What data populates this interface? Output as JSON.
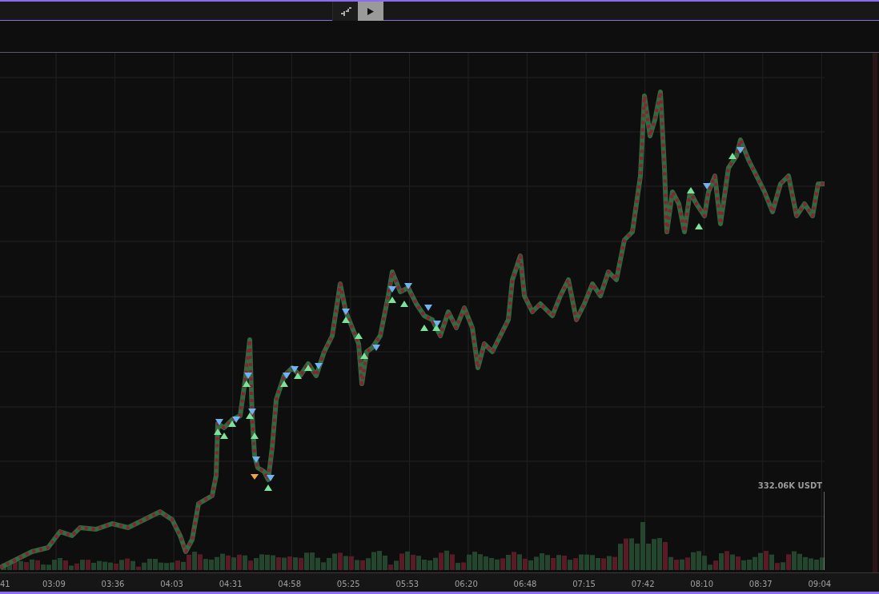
{
  "toolbar": {
    "buttons": [
      {
        "kind": "chart-style",
        "selected": false
      },
      {
        "kind": "play",
        "selected": true
      }
    ]
  },
  "volume": {
    "label": "332.06K USDT"
  },
  "x_axis": {
    "labels": [
      "41",
      "03:09",
      "03:36",
      "04:03",
      "04:31",
      "04:58",
      "05:25",
      "05:53",
      "06:20",
      "06:48",
      "07:15",
      "07:42",
      "08:10",
      "08:37",
      "09:04"
    ]
  }
}
